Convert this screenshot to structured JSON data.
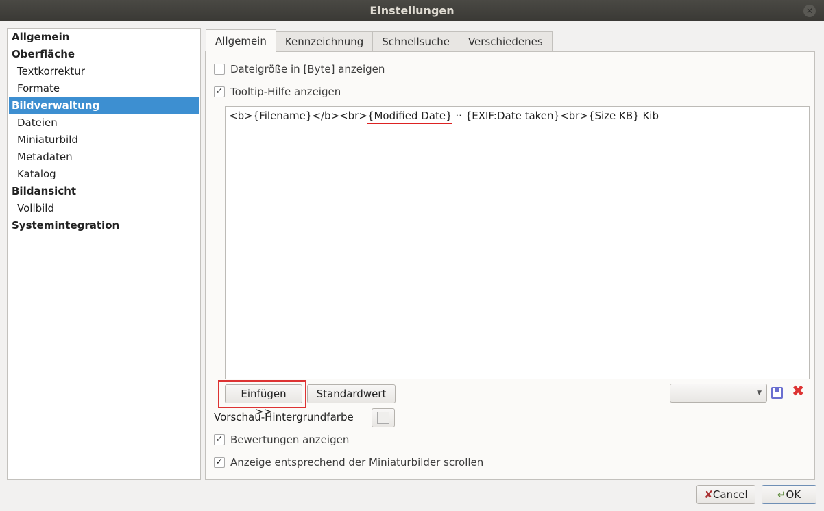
{
  "window": {
    "title": "Einstellungen"
  },
  "sidebar": {
    "items": [
      {
        "label": "Allgemein",
        "level": 0
      },
      {
        "label": "Oberfläche",
        "level": 0
      },
      {
        "label": "Textkorrektur",
        "level": 1
      },
      {
        "label": "Formate",
        "level": 1
      },
      {
        "label": "Bildverwaltung",
        "level": 0,
        "selected": true
      },
      {
        "label": "Dateien",
        "level": 1
      },
      {
        "label": "Miniaturbild",
        "level": 1
      },
      {
        "label": "Metadaten",
        "level": 1
      },
      {
        "label": "Katalog",
        "level": 1
      },
      {
        "label": "Bildansicht",
        "level": 0
      },
      {
        "label": "Vollbild",
        "level": 1
      },
      {
        "label": "Systemintegration",
        "level": 0
      }
    ]
  },
  "tabs": [
    "Allgemein",
    "Kennzeichnung",
    "Schnellsuche",
    "Verschiedenes"
  ],
  "options": {
    "filesize": {
      "label": "Dateigröße in [Byte] anzeigen",
      "checked": false
    },
    "tooltip": {
      "label": "Tooltip-Hilfe anzeigen",
      "checked": true
    },
    "ratings": {
      "label": "Bewertungen anzeigen",
      "checked": true
    },
    "scroll": {
      "label": "Anzeige entsprechend der Miniaturbilder scrollen",
      "checked": true
    }
  },
  "editor": {
    "part1": "<b>{Filename}</b><br>",
    "part2": "{Modified Date}",
    "part3": " ·· {EXIF:Date taken}<br>{Size KB} Kib"
  },
  "buttons": {
    "insert": "Einfügen >>",
    "default": "Standardwert",
    "cancel": "Cancel",
    "ok": "OK"
  },
  "preview_bg_label": "Vorschau-Hintergrundfarbe",
  "check_mark": "✓",
  "colors": {
    "selection": "#3d8fd1",
    "annotation": "#dd3333"
  }
}
